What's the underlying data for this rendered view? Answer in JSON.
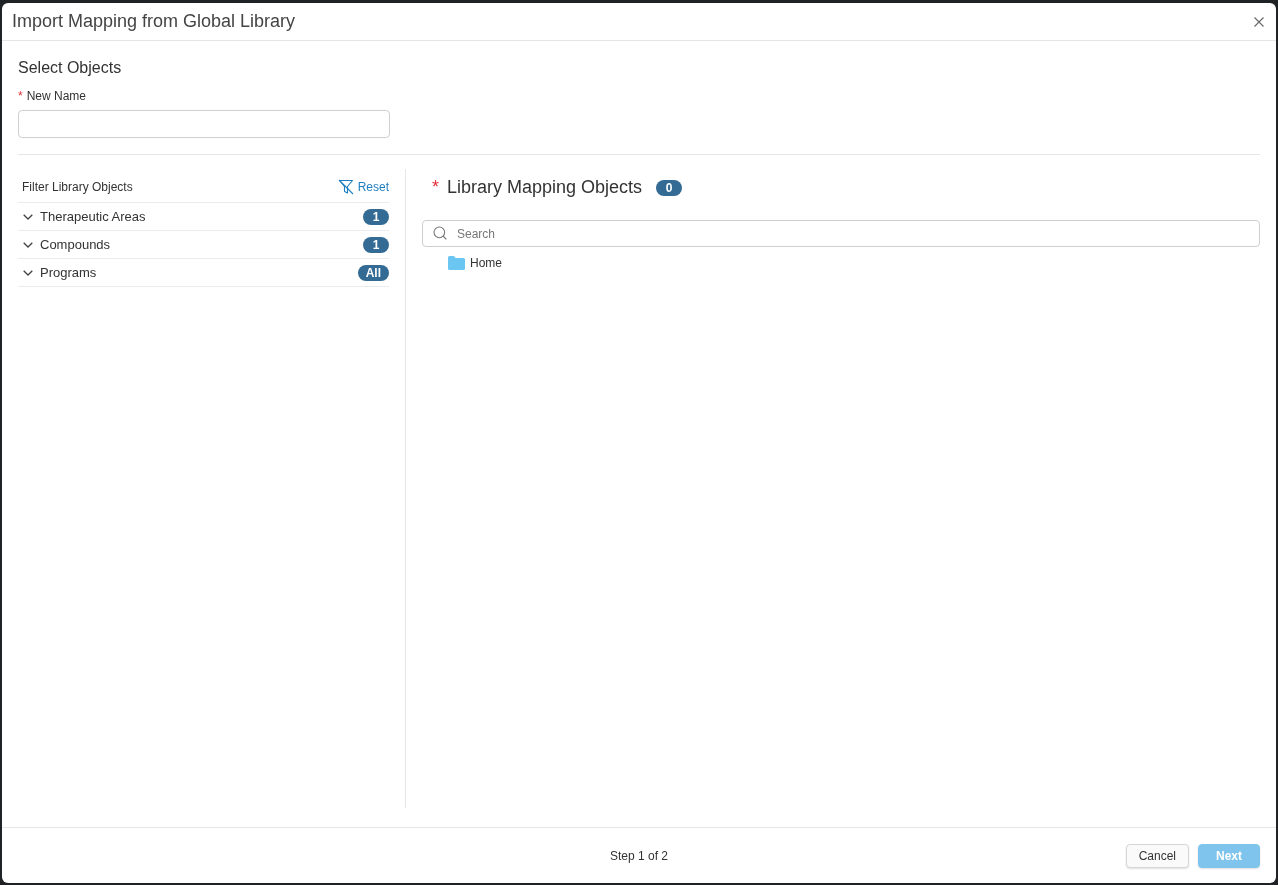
{
  "dialog": {
    "title": "Import Mapping from Global Library"
  },
  "section_title": "Select Objects",
  "new_name": {
    "required_mark": "*",
    "label": "New Name"
  },
  "filter": {
    "title": "Filter Library Objects",
    "reset_label": "Reset",
    "items": [
      {
        "label": "Therapeutic Areas",
        "count": "1",
        "expanded": false
      },
      {
        "label": "Compounds",
        "count": "1",
        "expanded": false
      },
      {
        "label": "Programs",
        "count": "All",
        "expanded": false
      }
    ]
  },
  "library": {
    "required_mark": "*",
    "title": "Library Mapping Objects",
    "count": "0",
    "search": {
      "placeholder": "Search"
    },
    "tree": [
      {
        "label": "Home",
        "kind": "folder"
      }
    ]
  },
  "footer": {
    "step": "Step 1 of 2",
    "buttons": [
      {
        "label": "Cancel",
        "kind": "secondary",
        "disabled": false
      },
      {
        "label": "Next",
        "kind": "primary",
        "disabled": true
      }
    ]
  }
}
